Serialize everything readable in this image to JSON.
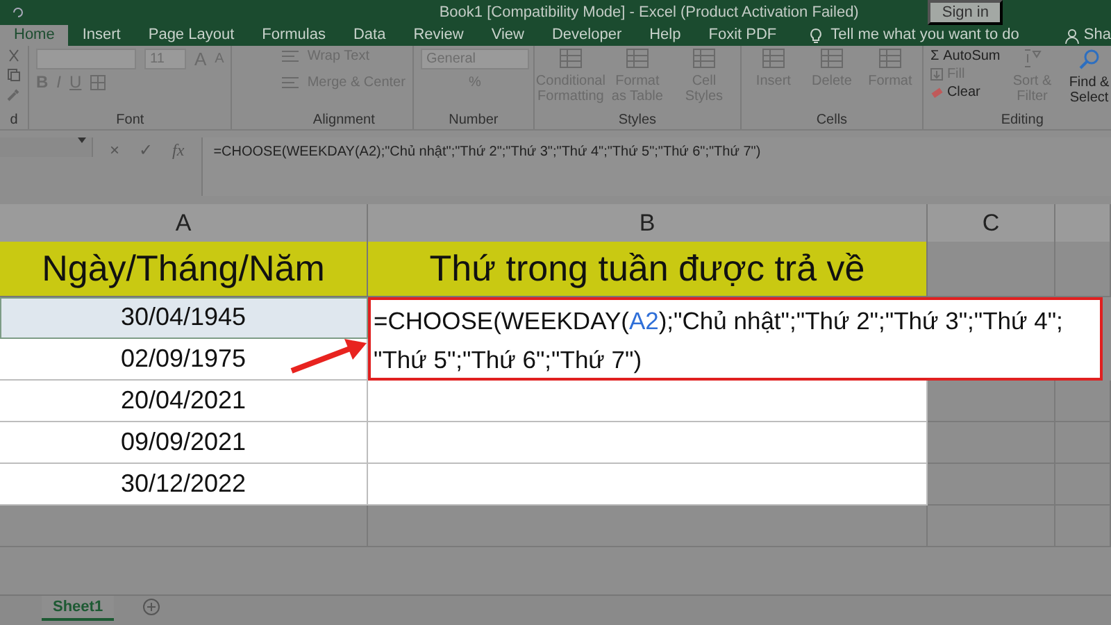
{
  "title_bar": {
    "title": "Book1  [Compatibility Mode]  -  Excel (Product Activation Failed)",
    "sign_in": "Sign in"
  },
  "tabs": [
    {
      "label": "Home",
      "selected": true
    },
    {
      "label": "Insert",
      "selected": false
    },
    {
      "label": "Page Layout",
      "selected": false
    },
    {
      "label": "Formulas",
      "selected": false
    },
    {
      "label": "Data",
      "selected": false
    },
    {
      "label": "Review",
      "selected": false
    },
    {
      "label": "View",
      "selected": false
    },
    {
      "label": "Developer",
      "selected": false
    },
    {
      "label": "Help",
      "selected": false
    },
    {
      "label": "Foxit PDF",
      "selected": false
    }
  ],
  "tell_me": "Tell me what you want to do",
  "share": "Sha",
  "ribbon": [
    {
      "kind": "clipboard",
      "label": "d"
    },
    {
      "kind": "font",
      "font_size": "11",
      "grow": "A",
      "shrink": "A",
      "format_buttons": [
        "B",
        "I",
        "U"
      ],
      "label": "Font"
    },
    {
      "kind": "alignment",
      "buttons": [
        "Wrap Text",
        "Merge & Center"
      ],
      "label": "Alignment"
    },
    {
      "kind": "number",
      "format": "General",
      "percent": "%",
      "label": "Number"
    },
    {
      "kind": "styles",
      "buttons": [
        "Conditional Formatting",
        "Format as Table",
        "Cell Styles"
      ],
      "label": "Styles"
    },
    {
      "kind": "cells",
      "buttons": [
        "Insert",
        "Delete",
        "Format"
      ],
      "label": "Cells"
    },
    {
      "kind": "editing",
      "sigma": "Σ",
      "buttons": [
        "AutoSum",
        "Fill",
        "Clear"
      ],
      "sort": "Sort & Filter",
      "find": "Find & Select",
      "label": "Editing"
    }
  ],
  "formula_bar": {
    "cancel": "×",
    "enter": "✓",
    "fx": "fx",
    "formula": "=CHOOSE(WEEKDAY(A2);\"Chủ nhật\";\"Thứ 2\";\"Thứ 3\";\"Thứ 4\";\"Thứ 5\";\"Thứ 6\";\"Thứ 7\")"
  },
  "columns": [
    "A",
    "B",
    "C"
  ],
  "table": {
    "headers": [
      "Ngày/Tháng/Năm",
      "Thứ trong tuần được trả về"
    ],
    "rows": [
      {
        "date": "30/04/1945",
        "selected": true
      },
      {
        "date": "02/09/1975",
        "selected": false
      },
      {
        "date": "20/04/2021",
        "selected": false
      },
      {
        "date": "09/09/2021",
        "selected": false
      },
      {
        "date": "30/12/2022",
        "selected": false
      }
    ]
  },
  "formula_edit": {
    "line_1": [
      {
        "kind": "text",
        "text": "=CHOOSE(WEEKDAY("
      },
      {
        "kind": "reference",
        "text": "A2",
        "color": "#2f6fd8"
      },
      {
        "kind": "text",
        "text": ");\"Chủ nhật\";\"Thứ 2\";\"Thứ 3\";\"Thứ 4\";"
      }
    ],
    "line_2": "\"Thứ 5\";\"Thứ 6\";\"Thứ 7\")"
  },
  "sheet_tabs": [
    {
      "label": "Sheet1",
      "selected": true
    }
  ]
}
